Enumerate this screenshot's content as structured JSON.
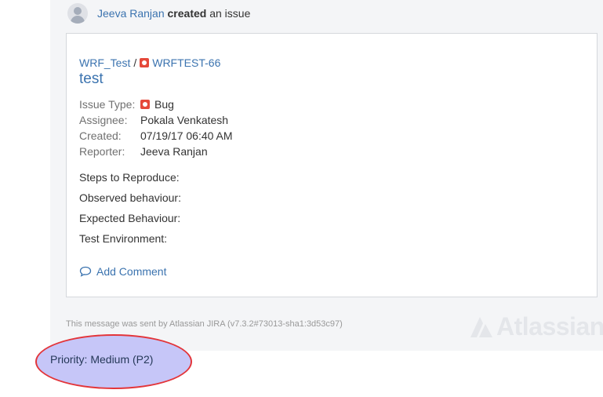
{
  "header": {
    "actor": "Jeeva Ranjan",
    "action_bold": "created",
    "action_rest": "an issue"
  },
  "issue": {
    "project": "WRF_Test",
    "separator": "/",
    "key": "WRFTEST-66",
    "title": "test",
    "fields": [
      {
        "label": "Issue Type:",
        "value": "Bug",
        "icon": "bug-icon",
        "is_link": false
      },
      {
        "label": "Assignee:",
        "value": "Pokala Venkatesh",
        "is_link": true
      },
      {
        "label": "Created:",
        "value": "07/19/17 06:40 AM",
        "is_link": false
      },
      {
        "label": "Reporter:",
        "value": "Jeeva Ranjan",
        "is_link": true
      }
    ],
    "sections": [
      "Steps to Reproduce:",
      "Observed behaviour:",
      "Expected Behaviour:",
      "Test Environment:"
    ],
    "add_comment": "Add Comment"
  },
  "footer": {
    "message": "This message was sent by Atlassian JIRA (v7.3.2#73013-sha1:3d53c97)",
    "logo": "Atlassian"
  },
  "annotation": {
    "priority": "Priority: Medium (P2)"
  },
  "colors": {
    "link": "#3b73af",
    "bug": "#e5493a",
    "highlight_fill": "#c6c6f8",
    "highlight_border": "#e3353a"
  }
}
